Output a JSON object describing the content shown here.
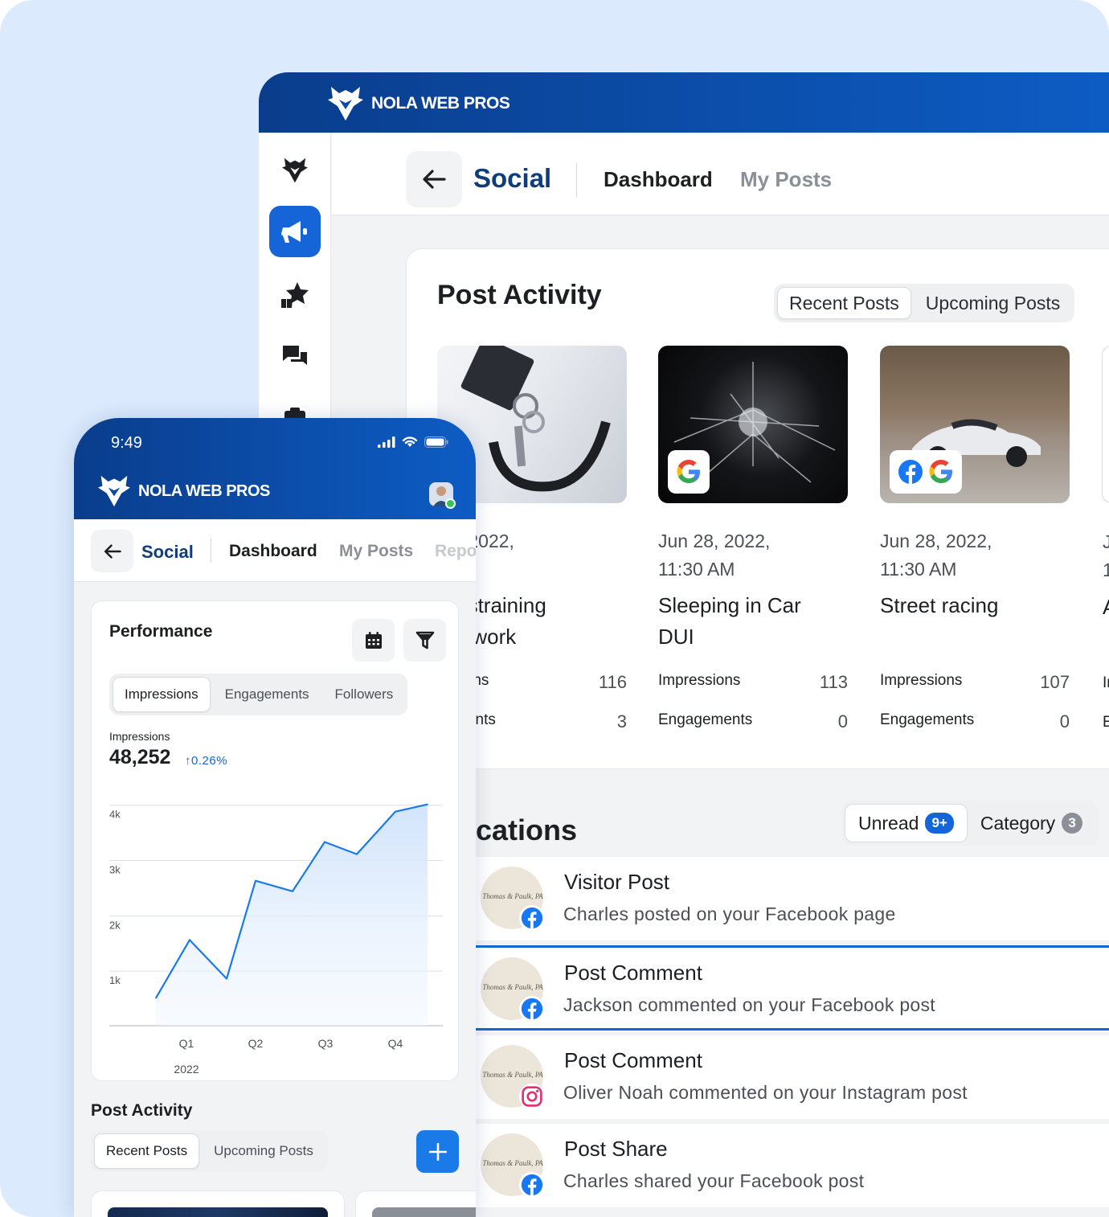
{
  "brand": {
    "name": "NOLA WEB PROS"
  },
  "desktop": {
    "nav": {
      "section": "Social",
      "tabs": [
        "Dashboard",
        "My Posts"
      ]
    },
    "post_activity": {
      "title": "Post Activity",
      "toggle": [
        "Recent Posts",
        "Upcoming Posts"
      ],
      "posts": [
        {
          "date_line1": "28, 2022,",
          "date_line2": ") AM",
          "title_line1": "/ restraining",
          "title_line2": "ers work",
          "stat1_label": "essions",
          "stat1_value": "116",
          "stat2_label": "gements",
          "stat2_value": "3"
        },
        {
          "date_line1": "Jun 28, 2022,",
          "date_line2": "11:30 AM",
          "title_line1": "Sleeping in Car",
          "title_line2": "DUI",
          "stat1_label": "Impressions",
          "stat1_value": "113",
          "stat2_label": "Engagements",
          "stat2_value": "0"
        },
        {
          "date_line1": "Jun 28, 2022,",
          "date_line2": "11:30 AM",
          "title_line1": "Street racing",
          "title_line2": "",
          "stat1_label": "Impressions",
          "stat1_value": "107",
          "stat2_label": "Engagements",
          "stat2_value": "0"
        }
      ],
      "partial_col": {
        "date_line1": "J",
        "date_line2": "1",
        "title": "A",
        "stat1": "Ir",
        "stat2": "E"
      }
    },
    "notifications": {
      "title": "ications",
      "unread_label": "Unread",
      "unread_count": "9+",
      "category_label": "Category",
      "category_count": "3",
      "avatar_text": "Thomas & Paulk, PA",
      "items": [
        {
          "title": "Visitor Post",
          "desc": "Charles  posted on your Facebook page",
          "source": "facebook"
        },
        {
          "title": "Post Comment",
          "desc": "Jackson commented on your Facebook post",
          "source": "facebook"
        },
        {
          "title": "Post Comment",
          "desc": "Oliver Noah commented on your Instagram post",
          "source": "instagram"
        },
        {
          "title": "Post Share",
          "desc": "Charles  shared your Facebook post",
          "source": "facebook"
        }
      ]
    }
  },
  "phone": {
    "time": "9:49",
    "nav": {
      "section": "Social",
      "tabs": [
        "Dashboard",
        "My Posts",
        "Repo"
      ]
    },
    "performance": {
      "title": "Performance",
      "tabs": [
        "Impressions",
        "Engagements",
        "Followers"
      ],
      "metric_label": "Impressions",
      "metric_value": "48,252",
      "metric_change": "0.26%"
    },
    "post_activity": {
      "title": "Post Activity",
      "toggle": [
        "Recent Posts",
        "Upcoming Posts"
      ]
    }
  },
  "chart_data": {
    "type": "area",
    "title": "",
    "xlabel": "2022",
    "ylabel": "",
    "categories": [
      "Q1",
      "Q2",
      "Q3",
      "Q4"
    ],
    "y_ticks": [
      "4k",
      "3k",
      "2k",
      "1k"
    ],
    "ylim": [
      0,
      4000
    ],
    "x": [
      0.3,
      0.8,
      1.25,
      1.7,
      2.1,
      2.5,
      3.0,
      3.45,
      3.9,
      4.4,
      4.9,
      5.4
    ],
    "values": [
      500,
      1550,
      850,
      2620,
      2430,
      3320,
      3100,
      3870,
      4000
    ],
    "accent": "#1a7ae8"
  }
}
